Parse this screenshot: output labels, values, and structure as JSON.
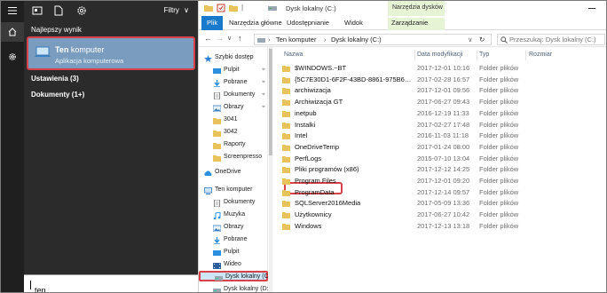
{
  "search": {
    "filters_label": "Filtry",
    "best_result_heading": "Najlepszy wynik",
    "best_result": {
      "title_bold": "Ten",
      "title_rest": " komputer",
      "subtitle": "Aplikacja komputerowa"
    },
    "categories": [
      "Ustawienia (3)",
      "Dokumenty (1+)"
    ],
    "query": "ten"
  },
  "explorer": {
    "window_title": "Dysk lokalny (C:)",
    "context_tab_group": "Narzędzia dysków",
    "ribbon_tabs": [
      "Plik",
      "Narzędzia główne",
      "Udostępnianie",
      "Widok",
      "Zarządzanie"
    ],
    "breadcrumb": [
      "Ten komputer",
      "Dysk lokalny (C:)"
    ],
    "search_placeholder": "Przeszukaj: Dysk lokalny (C:)",
    "nav_items": [
      {
        "label": "Szybki dostęp",
        "icon": "star-icon",
        "pinned": false
      },
      {
        "label": "Pulpit",
        "icon": "desktop-icon",
        "pinned": true
      },
      {
        "label": "Pobrane",
        "icon": "download-icon",
        "pinned": true
      },
      {
        "label": "Dokumenty",
        "icon": "document-icon",
        "pinned": true
      },
      {
        "label": "Obrazy",
        "icon": "picture-icon",
        "pinned": true
      },
      {
        "label": "3041",
        "icon": "folder-icon",
        "pinned": false
      },
      {
        "label": "3042",
        "icon": "folder-icon",
        "pinned": false
      },
      {
        "label": "Raporty",
        "icon": "folder-icon",
        "pinned": false
      },
      {
        "label": "Screenpresso",
        "icon": "folder-icon",
        "pinned": false
      },
      {
        "label": "OneDrive",
        "icon": "cloud-icon",
        "pinned": false
      },
      {
        "label": "Ten komputer",
        "icon": "computer-icon",
        "pinned": false
      },
      {
        "label": "Dokumenty",
        "icon": "document-icon",
        "pinned": false
      },
      {
        "label": "Muzyka",
        "icon": "music-icon",
        "pinned": false
      },
      {
        "label": "Obrazy",
        "icon": "picture-icon",
        "pinned": false
      },
      {
        "label": "Pobrane",
        "icon": "download-icon",
        "pinned": false
      },
      {
        "label": "Pulpit",
        "icon": "desktop-icon",
        "pinned": false
      },
      {
        "label": "Wideo",
        "icon": "video-icon",
        "pinned": false
      },
      {
        "label": "Dysk lokalny (C:)",
        "icon": "drive-icon",
        "pinned": false
      },
      {
        "label": "Dysk lokalny (D:)",
        "icon": "drive-icon",
        "pinned": false
      }
    ],
    "columns": [
      "Nazwa",
      "Data modyfikacji",
      "Typ",
      "Rozmiar"
    ],
    "files": [
      {
        "name": "$WINDOWS.~BT",
        "date": "2017-12-01 10:16",
        "type": "Folder plików"
      },
      {
        "name": "{5C7E30D1-6F2F-43BD-8861-975B6A57AF...",
        "date": "2017-02-28 16:57",
        "type": "Folder plików"
      },
      {
        "name": "archiwizacja",
        "date": "2017-12-01 09:56",
        "type": "Folder plików"
      },
      {
        "name": "Archiwizacja GT",
        "date": "2017-06-27 09:43",
        "type": "Folder plików"
      },
      {
        "name": "inetpub",
        "date": "2016-12-19 11:33",
        "type": "Folder plików"
      },
      {
        "name": "Instalki",
        "date": "2017-02-27 17:48",
        "type": "Folder plików"
      },
      {
        "name": "Intel",
        "date": "2016-11-03 11:18",
        "type": "Folder plików"
      },
      {
        "name": "OneDriveTemp",
        "date": "2017-01-24 08:00",
        "type": "Folder plików"
      },
      {
        "name": "PerfLogs",
        "date": "2015-07-10 13:04",
        "type": "Folder plików"
      },
      {
        "name": "Pliki programów (x86)",
        "date": "2017-12-12 14:25",
        "type": "Folder plików"
      },
      {
        "name": "Program Files",
        "date": "2017-12-01 09:20",
        "type": "Folder plików"
      },
      {
        "name": "ProgramData",
        "date": "2017-12-14 09:57",
        "type": "Folder plików"
      },
      {
        "name": "SQLServer2016Media",
        "date": "2017-05-09 13:36",
        "type": "Folder plików"
      },
      {
        "name": "Użytkownicy",
        "date": "2017-06-27 10:42",
        "type": "Folder plików"
      },
      {
        "name": "Windows",
        "date": "2017-12-13 13:18",
        "type": "Folder plików"
      }
    ]
  }
}
